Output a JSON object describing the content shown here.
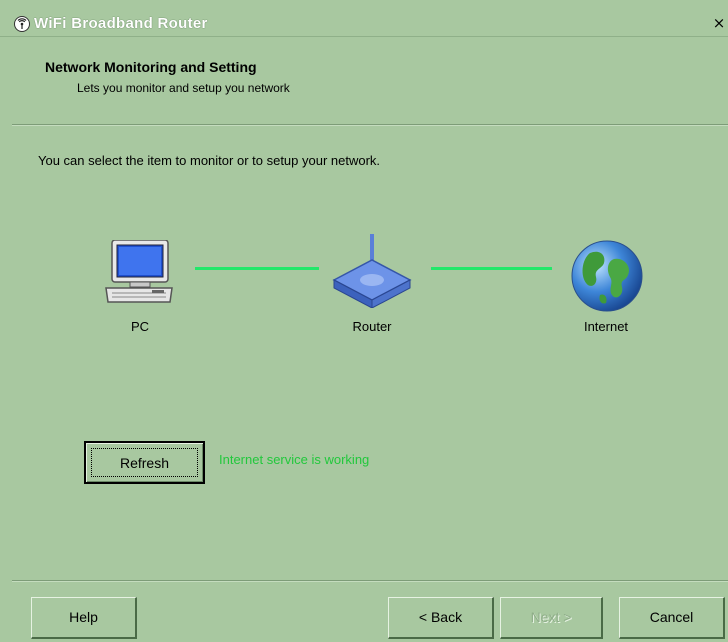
{
  "window": {
    "title": "WiFi Broadband Router",
    "close_label": "×"
  },
  "header": {
    "title": "Network Monitoring and Setting",
    "subtitle": "Lets you monitor and setup you network"
  },
  "main": {
    "instruction": "You can select the item to monitor or to setup your network.",
    "nodes": [
      {
        "label": "PC",
        "icon": "pc-icon"
      },
      {
        "label": "Router",
        "icon": "router-icon"
      },
      {
        "label": "Internet",
        "icon": "globe-icon"
      }
    ],
    "link_color": "#22e86a",
    "refresh_label": "Refresh",
    "status": "Internet service is working",
    "status_color": "#22c83c"
  },
  "footer": {
    "help_label": "Help",
    "back_label": "< Back",
    "next_label": "Next >",
    "cancel_label": "Cancel"
  },
  "colors": {
    "background": "#a8c8a0"
  }
}
